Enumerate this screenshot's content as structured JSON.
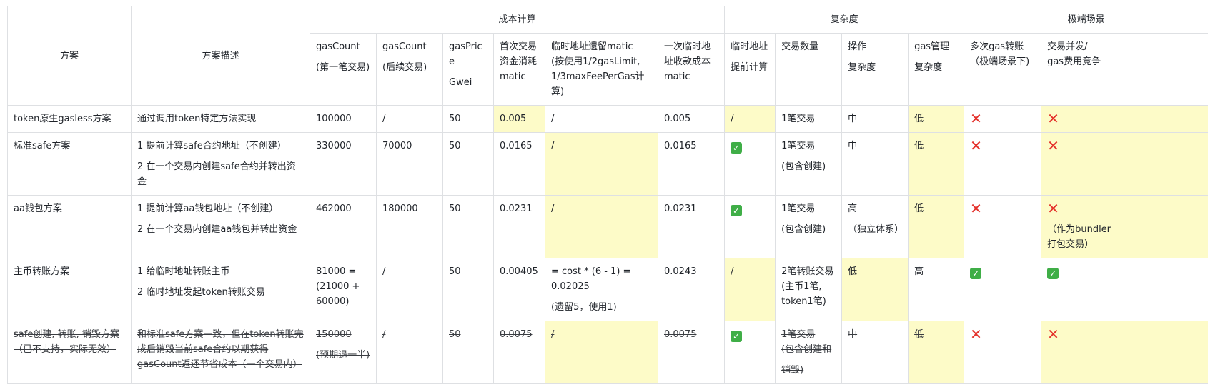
{
  "header": {
    "groups": {
      "plan": "方案",
      "desc": "方案描述",
      "cost": "成本计算",
      "complexity": "复杂度",
      "extreme": "极端场景"
    },
    "columns": [
      [
        "gasCount",
        "(第一笔交易)"
      ],
      [
        "gasCount",
        "(后续交易)"
      ],
      [
        "gasPrice",
        "Gwei"
      ],
      [
        "首次交易",
        "资金消耗",
        "matic"
      ],
      [
        "临时地址遗留matic",
        "(按使用1/2gasLimit,",
        "1/3maxFeePerGas计算)"
      ],
      [
        "一次临时地",
        "址收款成本",
        "matic"
      ],
      [
        "临时地址",
        "提前计算"
      ],
      [
        "交易数量"
      ],
      [
        "操作",
        "复杂度"
      ],
      [
        "gas管理",
        "复杂度"
      ],
      [
        "多次gas转账",
        "（极端场景下)"
      ],
      [
        "交易并发/",
        "gas费用竞争"
      ]
    ]
  },
  "rows": [
    {
      "plan": [
        "token原生gasless方案"
      ],
      "desc": [
        "通过调用token特定方法实现"
      ],
      "gas1": [
        "100000"
      ],
      "gas2": [
        "/"
      ],
      "price": [
        "50"
      ],
      "first": [
        "0.005"
      ],
      "leftover": [
        "/"
      ],
      "recv": [
        "0.005"
      ],
      "precalc": {
        "text": "/"
      },
      "count": [
        "1笔交易"
      ],
      "op": [
        "中"
      ],
      "gasmgmt": [
        "低"
      ],
      "multi": {
        "icon": "cross"
      },
      "concur": {
        "icon": "cross",
        "text": []
      }
    },
    {
      "plan": [
        "标准safe方案"
      ],
      "desc": [
        "1 提前计算safe合约地址（不创建）",
        "2 在一个交易内创建safe合约并转出资金"
      ],
      "gas1": [
        "330000"
      ],
      "gas2": [
        "70000"
      ],
      "price": [
        "50"
      ],
      "first": [
        "0.0165"
      ],
      "leftover": [
        "/"
      ],
      "recv": [
        "0.0165"
      ],
      "precalc": {
        "icon": "check"
      },
      "count": [
        "1笔交易",
        "(包含创建)"
      ],
      "op": [
        "中"
      ],
      "gasmgmt": [
        "低"
      ],
      "multi": {
        "icon": "cross"
      },
      "concur": {
        "icon": "cross",
        "text": []
      }
    },
    {
      "plan": [
        "aa钱包方案"
      ],
      "desc": [
        "1 提前计算aa钱包地址（不创建）",
        "2 在一个交易内创建aa钱包并转出资金"
      ],
      "gas1": [
        "462000"
      ],
      "gas2": [
        "180000"
      ],
      "price": [
        "50"
      ],
      "first": [
        "0.0231"
      ],
      "leftover": [
        "/"
      ],
      "recv": [
        "0.0231"
      ],
      "precalc": {
        "icon": "check"
      },
      "count": [
        "1笔交易",
        "(包含创建)"
      ],
      "op": [
        "高",
        "（独立体系）"
      ],
      "gasmgmt": [
        "低"
      ],
      "multi": {
        "icon": "cross"
      },
      "concur": {
        "icon": "cross",
        "text": [
          "（作为bundler",
          "打包交易）"
        ]
      }
    },
    {
      "plan": [
        "主币转账方案"
      ],
      "desc": [
        "1 给临时地址转账主币",
        "2 临时地址发起token转账交易"
      ],
      "gas1": [
        "81000 =",
        "(21000 +",
        "60000)"
      ],
      "gas2": [
        "/"
      ],
      "price": [
        "50"
      ],
      "first": [
        "0.00405"
      ],
      "leftover": [
        "= cost * (6 - 1) =",
        "0.02025",
        "(遗留5，使用1)"
      ],
      "recv": [
        "0.0243"
      ],
      "precalc": {
        "text": "/"
      },
      "count": [
        "2笔转账交易",
        "(主币1笔,",
        "token1笔)"
      ],
      "op": [
        "低"
      ],
      "gasmgmt": [
        "高"
      ],
      "multi": {
        "icon": "check"
      },
      "concur": {
        "icon": "check",
        "text": []
      }
    },
    {
      "plan": [
        "safe创建, 转账, 销毁方案",
        "（已不支持，实际无效）"
      ],
      "desc": [
        "和标准safe方案一致，但在token转账完",
        "成后销毁当前safe合约以期获得",
        "gasCount返还节省成本（一个交易内）"
      ],
      "gas1": [
        "150000",
        "(预期退一半)"
      ],
      "gas2": [
        "/"
      ],
      "price": [
        "50"
      ],
      "first": [
        "0.0075"
      ],
      "leftover": [
        "/"
      ],
      "recv": [
        "0.0075"
      ],
      "precalc": {
        "icon": "check"
      },
      "count": [
        "1笔交易",
        "(包含创建和",
        "销毁)"
      ],
      "op": [
        "中"
      ],
      "gasmgmt": [
        "低"
      ],
      "multi": {
        "icon": "cross"
      },
      "concur": {
        "icon": "cross",
        "text": []
      }
    }
  ],
  "icons": {
    "cross": "cross-mark-icon",
    "check": "check-mark-icon"
  },
  "colors": {
    "highlight": "#fdfbc8",
    "cross": "#e4312b",
    "check": "#3fae47",
    "border": "#dee0e3"
  }
}
